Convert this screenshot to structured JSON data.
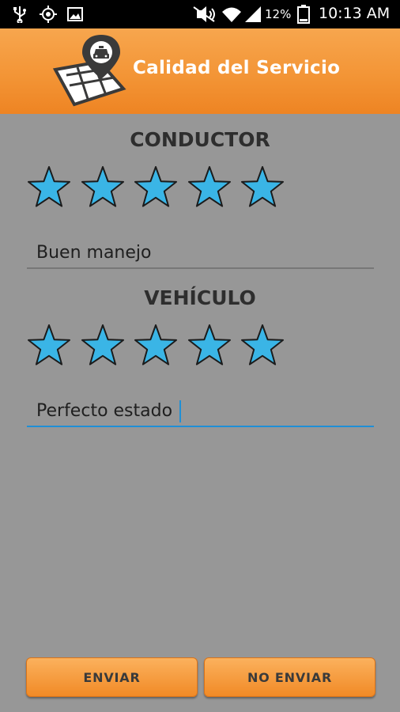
{
  "status_bar": {
    "icons_left": [
      "usb-icon",
      "gps-icon",
      "image-icon"
    ],
    "icons_right": [
      "mute-icon",
      "wifi-icon",
      "signal-icon",
      "battery-icon"
    ],
    "battery": "12%",
    "time": "10:13 AM"
  },
  "header": {
    "title": "Calidad del Servicio",
    "logo_icon": "map-pin-taxi-icon"
  },
  "driver": {
    "title": "CONDUCTOR",
    "rating": 5,
    "max_rating": 5,
    "comment": "Buen manejo"
  },
  "vehicle": {
    "title": "VEHÍCULO",
    "rating": 5,
    "max_rating": 5,
    "comment": "Perfecto estado"
  },
  "buttons": {
    "send": "ENVIAR",
    "dont_send": "NO ENVIAR"
  },
  "colors": {
    "header_orange": "#f39536",
    "background": "#979797",
    "star_fill": "#3ab5e6",
    "focus_underline": "#1f8fd6"
  }
}
